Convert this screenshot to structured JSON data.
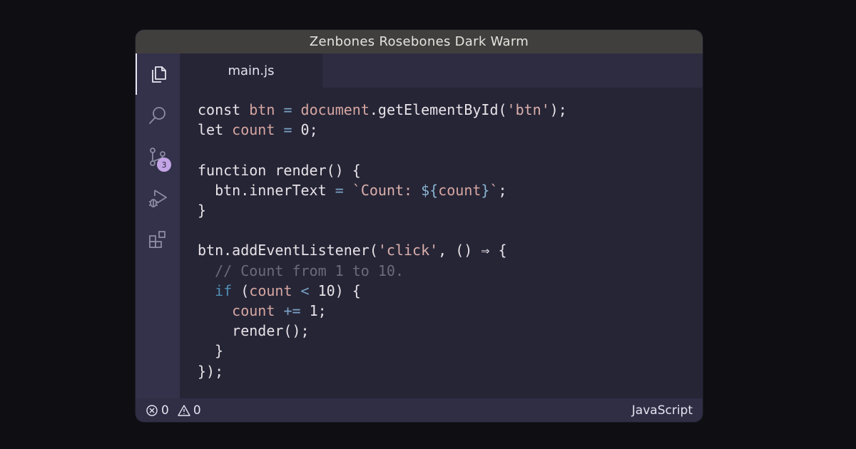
{
  "window": {
    "title": "Zenbones Rosebones Dark Warm"
  },
  "activity_bar": {
    "items": [
      {
        "icon": "files-icon",
        "active": true
      },
      {
        "icon": "search-icon"
      },
      {
        "icon": "source-control-icon",
        "badge": "3"
      },
      {
        "icon": "run-debug-icon"
      },
      {
        "icon": "extensions-icon"
      }
    ]
  },
  "tabs": [
    {
      "label": "main.js",
      "active": true
    }
  ],
  "editor": {
    "language": "JavaScript",
    "lines": [
      "const btn = document.getElementById('btn');",
      "let count = 0;",
      "",
      "function render() {",
      "  btn.innerText = `Count: ${count}`;",
      "}",
      "",
      "btn.addEventListener('click', () ⇒ {",
      "  // Count from 1 to 10.",
      "  if (count < 10) {",
      "    count += 1;",
      "    render();",
      "  }",
      "});"
    ]
  },
  "status_bar": {
    "errors": "0",
    "warnings": "0",
    "language": "JavaScript"
  },
  "colors": {
    "background": "#0e0e13",
    "editor_bg": "#262536",
    "activity_bg": "#33324a",
    "titlebar_bg": "#403f3d",
    "badge": "#c3a5e6",
    "string": "#dbb0ac",
    "variable": "#d7a7a2",
    "operator": "#7ba2c5",
    "comment": "#6c6b7e",
    "keyword_if": "#4f8fb3"
  }
}
